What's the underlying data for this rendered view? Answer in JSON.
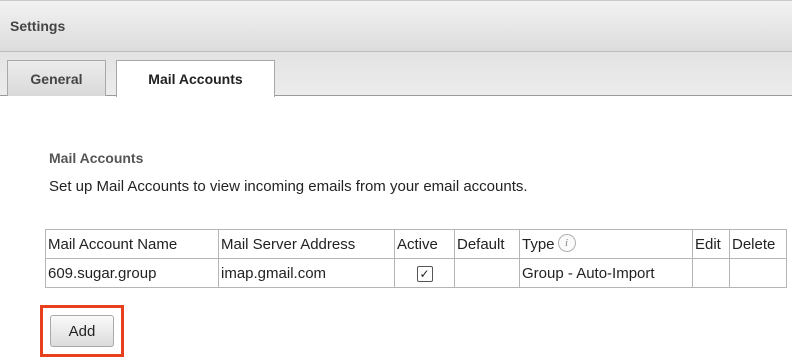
{
  "header": {
    "title": "Settings"
  },
  "tabs": [
    {
      "label": "General"
    },
    {
      "label": "Mail Accounts",
      "active": true
    }
  ],
  "section": {
    "title": "Mail Accounts",
    "description": "Set up Mail Accounts to view incoming emails from your email accounts."
  },
  "table": {
    "columns": [
      "Mail Account Name",
      "Mail Server Address",
      "Active",
      "Default",
      "Type",
      "Edit",
      "Delete"
    ],
    "rows": [
      {
        "name": "609.sugar.group",
        "server": "imap.gmail.com",
        "active": true,
        "default": "",
        "type": "Group - Auto-Import",
        "edit": "",
        "delete": ""
      }
    ]
  },
  "buttons": {
    "add_label": "Add"
  },
  "colors": {
    "highlight": "#e8401c"
  }
}
